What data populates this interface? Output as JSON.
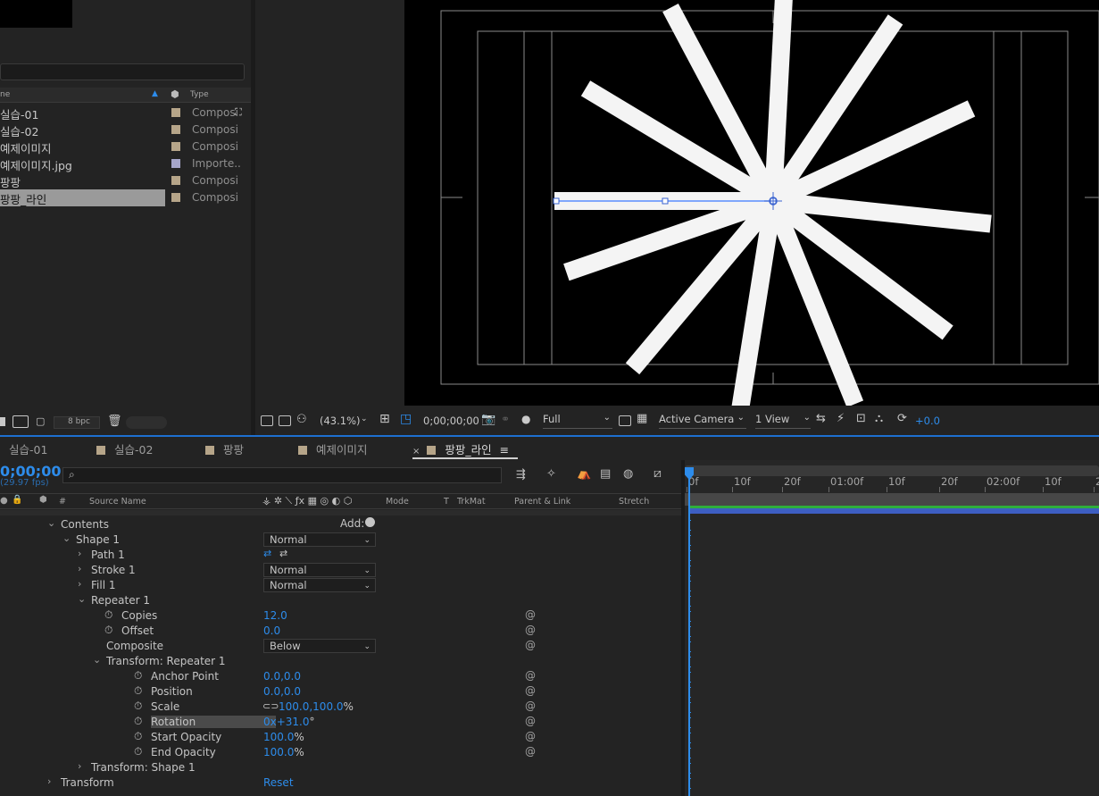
{
  "project": {
    "top_text": "",
    "header": {
      "name_col": "ne",
      "type_col": "Type"
    },
    "items": [
      {
        "name": "실습-01",
        "type": "Composi",
        "color": "#b6a589"
      },
      {
        "name": "실습-02",
        "type": "Composi",
        "color": "#b6a589"
      },
      {
        "name": "예제이미지",
        "type": "Composi",
        "color": "#b6a589"
      },
      {
        "name": "예제이미지.jpg",
        "type": "Importe..",
        "color": "#a5a5c9"
      },
      {
        "name": "팡팡",
        "type": "Composi",
        "color": "#b6a589"
      },
      {
        "name": "팡팡_라인",
        "type": "Composi",
        "color": "#b6a589",
        "selected": true
      }
    ],
    "footer": {
      "bpc": "8 bpc"
    }
  },
  "viewer": {
    "zoom": "(43.1%)",
    "timecode": "0;00;00;00",
    "resolution": "Full",
    "camera": "Active Camera",
    "views": "1 View",
    "exposure": "+0.0"
  },
  "tabs": [
    {
      "label": "실습-01",
      "color": "#b6a589",
      "active": false
    },
    {
      "label": "실습-02",
      "color": "#b6a589",
      "active": false
    },
    {
      "label": "팡팡",
      "color": "#b6a589",
      "active": false
    },
    {
      "label": "예제이미지",
      "color": "#b6a589",
      "active": false
    },
    {
      "label": "팡팡_라인",
      "color": "#b6a589",
      "active": true
    }
  ],
  "timeline": {
    "current_time": "0;00;00",
    "fps": "(29.97 fps)",
    "columns": {
      "source_name": "Source Name",
      "mode": "Mode",
      "t": "T",
      "trkmat": "TrkMat",
      "parent": "Parent & Link",
      "stretch": "Stretch"
    },
    "ruler": [
      "0f",
      "10f",
      "20f",
      "01:00f",
      "10f",
      "20f",
      "02:00f",
      "10f",
      "2"
    ],
    "add_label": "Add:",
    "rows": [
      {
        "label": "Contents",
        "indent": 1,
        "chev": "v"
      },
      {
        "label": "Shape 1",
        "indent": 2,
        "chev": "v",
        "dropdown": "Normal"
      },
      {
        "label": "Path 1",
        "indent": 3,
        "chev": ">"
      },
      {
        "label": "Stroke 1",
        "indent": 3,
        "chev": ">",
        "dropdown": "Normal"
      },
      {
        "label": "Fill 1",
        "indent": 3,
        "chev": ">",
        "dropdown": "Normal"
      },
      {
        "label": "Repeater 1",
        "indent": 3,
        "chev": "v"
      },
      {
        "label": "Copies",
        "indent": 4,
        "stopwatch": true,
        "value": "12.0",
        "pick": true
      },
      {
        "label": "Offset",
        "indent": 4,
        "stopwatch": true,
        "value": "0.0",
        "pick": true
      },
      {
        "label": "Composite",
        "indent": 4,
        "dropdown": "Below",
        "pick": true
      },
      {
        "label": "Transform: Repeater 1",
        "indent": 4,
        "chev": "v"
      },
      {
        "label": "Anchor Point",
        "indent": 5,
        "stopwatch": true,
        "value": "0.0,0.0",
        "pick": true
      },
      {
        "label": "Position",
        "indent": 5,
        "stopwatch": true,
        "value": "0.0,0.0",
        "pick": true
      },
      {
        "label": "Scale",
        "indent": 5,
        "stopwatch": true,
        "value": "100.0,100.0",
        "suffix": "%",
        "link": true,
        "pick": true
      },
      {
        "label": "Rotation",
        "indent": 5,
        "stopwatch": true,
        "value": "0x+31.0",
        "suffix": "°",
        "pick": true,
        "highlight": true
      },
      {
        "label": "Start Opacity",
        "indent": 5,
        "stopwatch": true,
        "value": "100.0",
        "suffix": "%",
        "pick": true
      },
      {
        "label": "End Opacity",
        "indent": 5,
        "stopwatch": true,
        "value": "100.0",
        "suffix": "%",
        "pick": true
      },
      {
        "label": "Transform: Shape 1",
        "indent": 3,
        "chev": ">"
      },
      {
        "label": "Transform",
        "indent": 1,
        "chev": ">",
        "value": "Reset"
      }
    ]
  },
  "colors": {
    "accent": "#2d8ceb",
    "comp": "#b6a589",
    "footage": "#a5a5c9"
  }
}
